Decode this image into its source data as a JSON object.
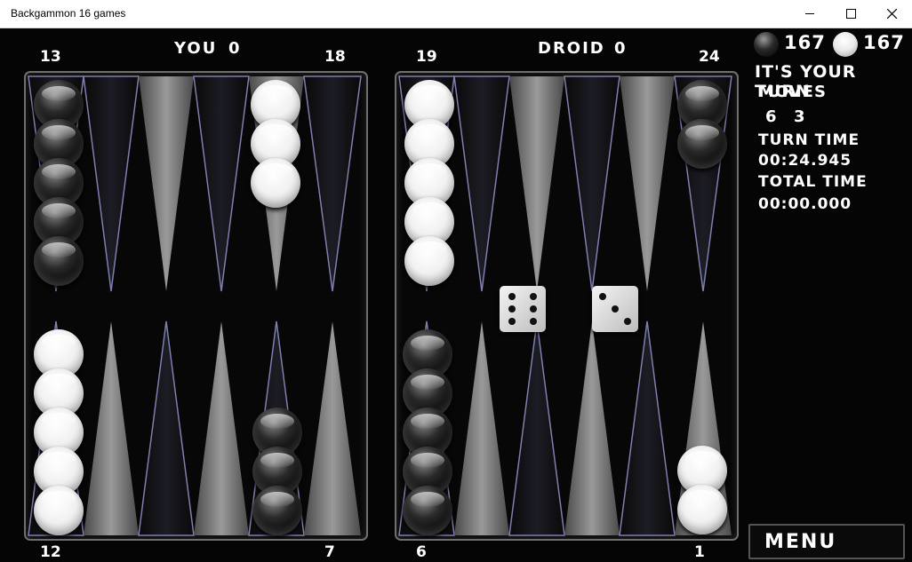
{
  "window": {
    "title": "Backgammon 16 games",
    "minimize_icon": "minimize-icon",
    "maximize_icon": "maximize-icon",
    "close_icon": "close-icon"
  },
  "scores": {
    "you_label": "YOU",
    "you_score": "0",
    "droid_label": "DROID",
    "droid_score": "0"
  },
  "point_numbers": {
    "top_left_outer": "13",
    "top_left_inner": "18",
    "top_right_inner": "19",
    "top_right_outer": "24",
    "bottom_left_outer": "12",
    "bottom_left_inner": "7",
    "bottom_right_inner": "6",
    "bottom_right_outer": "1"
  },
  "counts": {
    "black_count": "167",
    "white_count": "167"
  },
  "status": {
    "turn_message": "IT'S YOUR TURN",
    "moves_label": "MOVES",
    "move_values": [
      "6",
      "3"
    ],
    "turn_time_label": "TURN TIME",
    "turn_time_value": "00:24.945",
    "total_time_label": "TOTAL TIME",
    "total_time_value": "00:00.000"
  },
  "dice": [
    6,
    3
  ],
  "checkers": {
    "point_13": {
      "color": "black",
      "count": 5
    },
    "point_17": {
      "color": "white",
      "count": 3
    },
    "point_19": {
      "color": "white",
      "count": 5
    },
    "point_24": {
      "color": "black",
      "count": 2
    },
    "point_12": {
      "color": "white",
      "count": 5
    },
    "point_8": {
      "color": "black",
      "count": 3
    },
    "point_6": {
      "color": "black",
      "count": 5
    },
    "point_1": {
      "color": "white",
      "count": 2
    }
  },
  "menu": {
    "label": "MENU"
  }
}
